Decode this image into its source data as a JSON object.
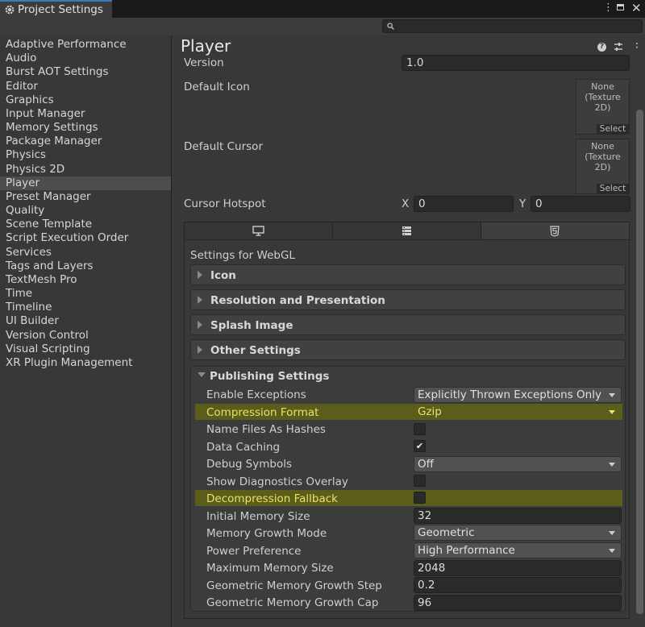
{
  "window": {
    "title": "Project Settings"
  },
  "search": {
    "placeholder": ""
  },
  "sidebar": {
    "items": [
      {
        "label": "Adaptive Performance"
      },
      {
        "label": "Audio"
      },
      {
        "label": "Burst AOT Settings"
      },
      {
        "label": "Editor"
      },
      {
        "label": "Graphics"
      },
      {
        "label": "Input Manager"
      },
      {
        "label": "Memory Settings"
      },
      {
        "label": "Package Manager"
      },
      {
        "label": "Physics"
      },
      {
        "label": "Physics 2D"
      },
      {
        "label": "Player",
        "selected": true
      },
      {
        "label": "Preset Manager"
      },
      {
        "label": "Quality"
      },
      {
        "label": "Scene Template"
      },
      {
        "label": "Script Execution Order"
      },
      {
        "label": "Services"
      },
      {
        "label": "Tags and Layers"
      },
      {
        "label": "TextMesh Pro"
      },
      {
        "label": "Time"
      },
      {
        "label": "Timeline"
      },
      {
        "label": "UI Builder"
      },
      {
        "label": "Version Control"
      },
      {
        "label": "Visual Scripting"
      },
      {
        "label": "XR Plugin Management"
      }
    ]
  },
  "player": {
    "heading": "Player",
    "version_label": "Version",
    "version_value": "1.0",
    "default_icon_label": "Default Icon",
    "default_cursor_label": "Default Cursor",
    "texture_none": "None",
    "texture_type": "(Texture 2D)",
    "select_label": "Select",
    "cursor_hotspot_label": "Cursor Hotspot",
    "hotspot_x_label": "X",
    "hotspot_x": "0",
    "hotspot_y_label": "Y",
    "hotspot_y": "0"
  },
  "platform_tabs": [
    {
      "icon": "monitor-icon"
    },
    {
      "icon": "server-icon"
    },
    {
      "icon": "html5-icon",
      "active": true
    }
  ],
  "webgl": {
    "settings_for": "Settings for WebGL",
    "foldouts": [
      "Icon",
      "Resolution and Presentation",
      "Splash Image",
      "Other Settings"
    ],
    "publishing_title": "Publishing Settings",
    "rows": {
      "enable_exceptions": {
        "label": "Enable Exceptions",
        "value": "Explicitly Thrown Exceptions Only"
      },
      "compression_format": {
        "label": "Compression Format",
        "value": "Gzip"
      },
      "name_files_as_hashes": {
        "label": "Name Files As Hashes",
        "checked": false
      },
      "data_caching": {
        "label": "Data Caching",
        "checked": true,
        "check": "✔"
      },
      "debug_symbols": {
        "label": "Debug Symbols",
        "value": "Off"
      },
      "show_diagnostics_overlay": {
        "label": "Show Diagnostics Overlay",
        "checked": false
      },
      "decompression_fallback": {
        "label": "Decompression Fallback",
        "checked": false
      },
      "initial_memory_size": {
        "label": "Initial Memory Size",
        "value": "32"
      },
      "memory_growth_mode": {
        "label": "Memory Growth Mode",
        "value": "Geometric"
      },
      "power_preference": {
        "label": "Power Preference",
        "value": "High Performance"
      },
      "maximum_memory_size": {
        "label": "Maximum Memory Size",
        "value": "2048"
      },
      "geometric_growth_step": {
        "label": "Geometric Memory Growth Step",
        "value": "0.2"
      },
      "geometric_growth_cap": {
        "label": "Geometric Memory Growth Cap",
        "value": "96"
      }
    }
  },
  "colors": {
    "highlight": "#5b5d1a",
    "highlight_text": "#e8e16a",
    "accent": "#3a79bb"
  }
}
